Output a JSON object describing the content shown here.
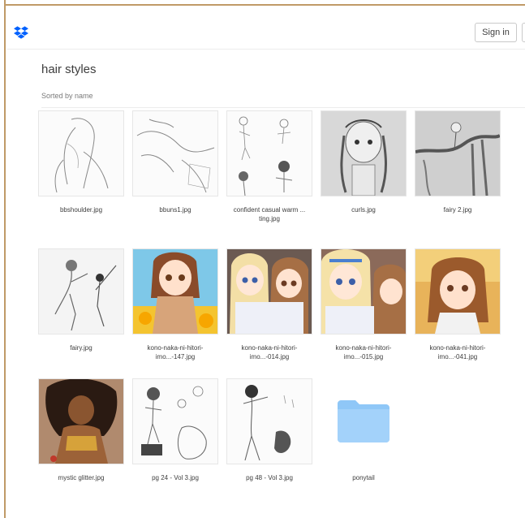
{
  "header": {
    "signin_label": "Sign in"
  },
  "folder": {
    "title": "hair styles",
    "sort_label": "Sorted by name"
  },
  "colors": {
    "frame": "#c09a67",
    "folder_blue": "#8fc7f7",
    "logo_blue": "#0061fe"
  },
  "items": [
    {
      "name": "bbshoulder.jpg",
      "kind": "image",
      "icon": "lineart-thumbnail"
    },
    {
      "name": "bbuns1.jpg",
      "kind": "image",
      "icon": "lineart-thumbnail"
    },
    {
      "name": "confident casual warm ... ting.jpg",
      "kind": "image",
      "icon": "lineart-thumbnail"
    },
    {
      "name": "curls.jpg",
      "kind": "image",
      "icon": "pencil-thumbnail"
    },
    {
      "name": "fairy 2.jpg",
      "kind": "image",
      "icon": "pencil-thumbnail"
    },
    {
      "name": "fairy.jpg",
      "kind": "image",
      "icon": "lineart-thumbnail"
    },
    {
      "name": "kono-naka-ni-hitori-imo...-147.jpg",
      "kind": "image",
      "icon": "color-thumbnail"
    },
    {
      "name": "kono-naka-ni-hitori-imo...-014.jpg",
      "kind": "image",
      "icon": "color-thumbnail"
    },
    {
      "name": "kono-naka-ni-hitori-imo...-015.jpg",
      "kind": "image",
      "icon": "color-thumbnail"
    },
    {
      "name": "kono-naka-ni-hitori-imo...-041.jpg",
      "kind": "image",
      "icon": "color-thumbnail"
    },
    {
      "name": "mystic glitter.jpg",
      "kind": "image",
      "icon": "color-thumbnail"
    },
    {
      "name": "pg 24 - Vol 3.jpg",
      "kind": "image",
      "icon": "lineart-thumbnail"
    },
    {
      "name": "pg 48 - Vol 3.jpg",
      "kind": "image",
      "icon": "lineart-thumbnail"
    },
    {
      "name": "ponytail",
      "kind": "folder",
      "icon": "folder-icon"
    }
  ]
}
